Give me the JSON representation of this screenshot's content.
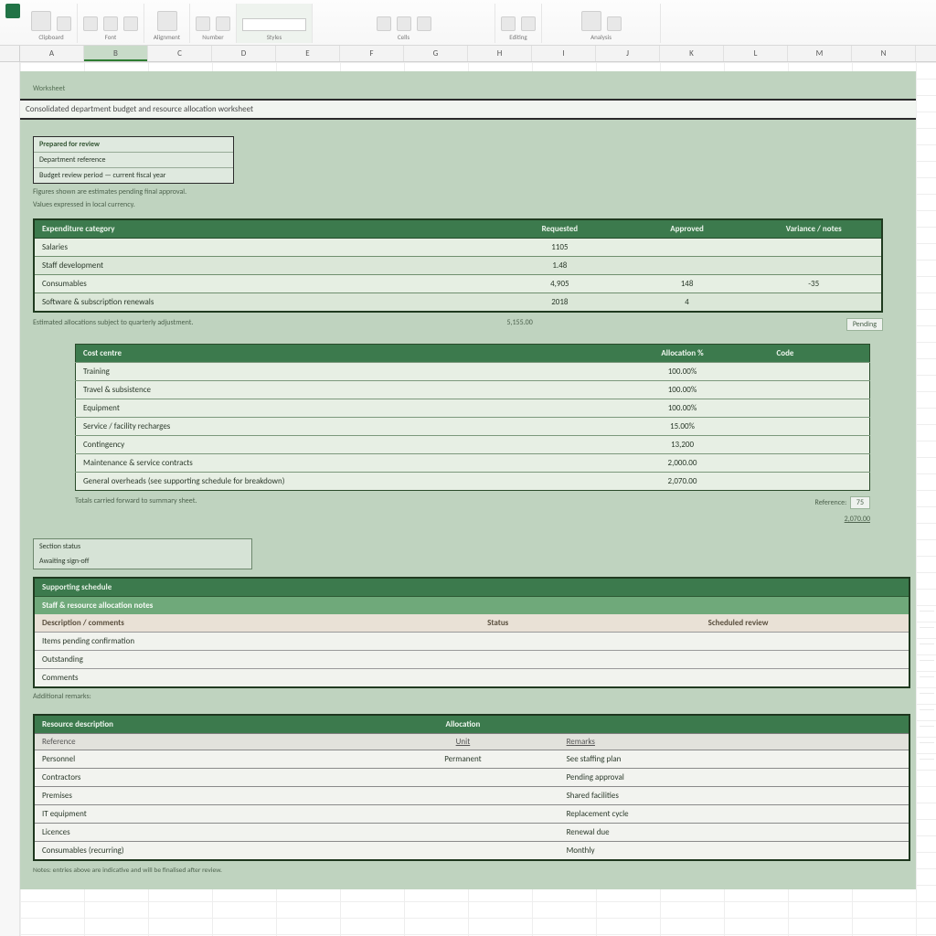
{
  "ribbon": {
    "groups": [
      {
        "label": "Clipboard"
      },
      {
        "label": "Font"
      },
      {
        "label": "Alignment"
      },
      {
        "label": "Number"
      },
      {
        "label": "Styles",
        "highlight": true
      },
      {
        "label": "Cells"
      },
      {
        "label": "Editing"
      },
      {
        "label": "Analysis"
      }
    ]
  },
  "columns": [
    "A",
    "B",
    "C",
    "D",
    "E",
    "F",
    "G",
    "H",
    "I",
    "J",
    "K",
    "L",
    "M",
    "N"
  ],
  "selected_col_index": 1,
  "doc": {
    "breadcrumb": "Worksheet",
    "title": "Consolidated department budget and resource allocation worksheet",
    "meta": {
      "head": "Prepared for review",
      "rows": [
        "Department reference",
        "Budget review period — current fiscal year"
      ],
      "notes": [
        "Figures shown are estimates pending final approval.",
        "Values expressed in local currency."
      ]
    },
    "table1": {
      "headers": [
        "Expenditure category",
        "Requested",
        "Approved",
        "Variance / notes"
      ],
      "rows": [
        {
          "a": "Salaries",
          "b": "1105",
          "c": "",
          "d": ""
        },
        {
          "a": "Staff development",
          "b": "1.48",
          "c": "",
          "d": ""
        },
        {
          "a": "Consumables",
          "b": "4,905",
          "c": "148",
          "d": "-35"
        },
        {
          "a": "Software & subscription renewals",
          "b": "2018",
          "c": "4",
          "d": ""
        }
      ],
      "footnote_left": "Estimated allocations subject to quarterly adjustment.",
      "footnote_mid": "5,155.00",
      "footnote_pill": "Pending"
    },
    "table2": {
      "headers": [
        "Cost centre",
        "Allocation %",
        "Code"
      ],
      "rows": [
        {
          "a": "Training",
          "b": "100.00%",
          "c": ""
        },
        {
          "a": "Travel & subsistence",
          "b": "100.00%",
          "c": ""
        },
        {
          "a": "Equipment",
          "b": "100.00%",
          "c": ""
        },
        {
          "a": "Service / facility recharges",
          "b": "15.00%",
          "c": ""
        },
        {
          "a": "Contingency",
          "b": "13,200",
          "c": ""
        },
        {
          "a": "Maintenance & service contracts",
          "b": "2,000.00",
          "c": ""
        },
        {
          "a": "General overheads (see supporting schedule for breakdown)",
          "b": "2,070.00",
          "c": ""
        }
      ],
      "foot_left": "Totals carried forward to summary sheet.",
      "foot_right_label": "Reference:",
      "foot_right_val": "75",
      "foot_link": "2,070.00"
    },
    "flag": {
      "line1": "Section status",
      "line2": "Awaiting sign-off"
    },
    "section3": {
      "head1": "Supporting schedule",
      "head2": "Staff & resource allocation notes",
      "headers": [
        "Description / comments",
        "Status",
        "Scheduled review"
      ],
      "rows": [
        {
          "a": "Items pending confirmation",
          "b": "",
          "c": ""
        },
        {
          "a": "Outstanding",
          "b": "",
          "c": ""
        },
        {
          "a": "Comments",
          "b": "",
          "c": ""
        }
      ],
      "note": "Additional remarks:"
    },
    "table4": {
      "head": [
        "Resource description",
        "Allocation",
        ""
      ],
      "sub": [
        "Reference",
        "Unit",
        "Remarks"
      ],
      "rows": [
        {
          "a": "Personnel",
          "b": "Permanent",
          "c": "See staffing plan"
        },
        {
          "a": "Contractors",
          "b": "",
          "c": "Pending approval"
        },
        {
          "a": "Premises",
          "b": "",
          "c": "Shared facilities"
        },
        {
          "a": "IT equipment",
          "b": "",
          "c": "Replacement cycle"
        },
        {
          "a": "Licences",
          "b": "",
          "c": "Renewal due"
        },
        {
          "a": "Consumables (recurring)",
          "b": "",
          "c": "Monthly"
        }
      ],
      "footnote": "Notes: entries above are indicative and will be finalised after review."
    }
  }
}
